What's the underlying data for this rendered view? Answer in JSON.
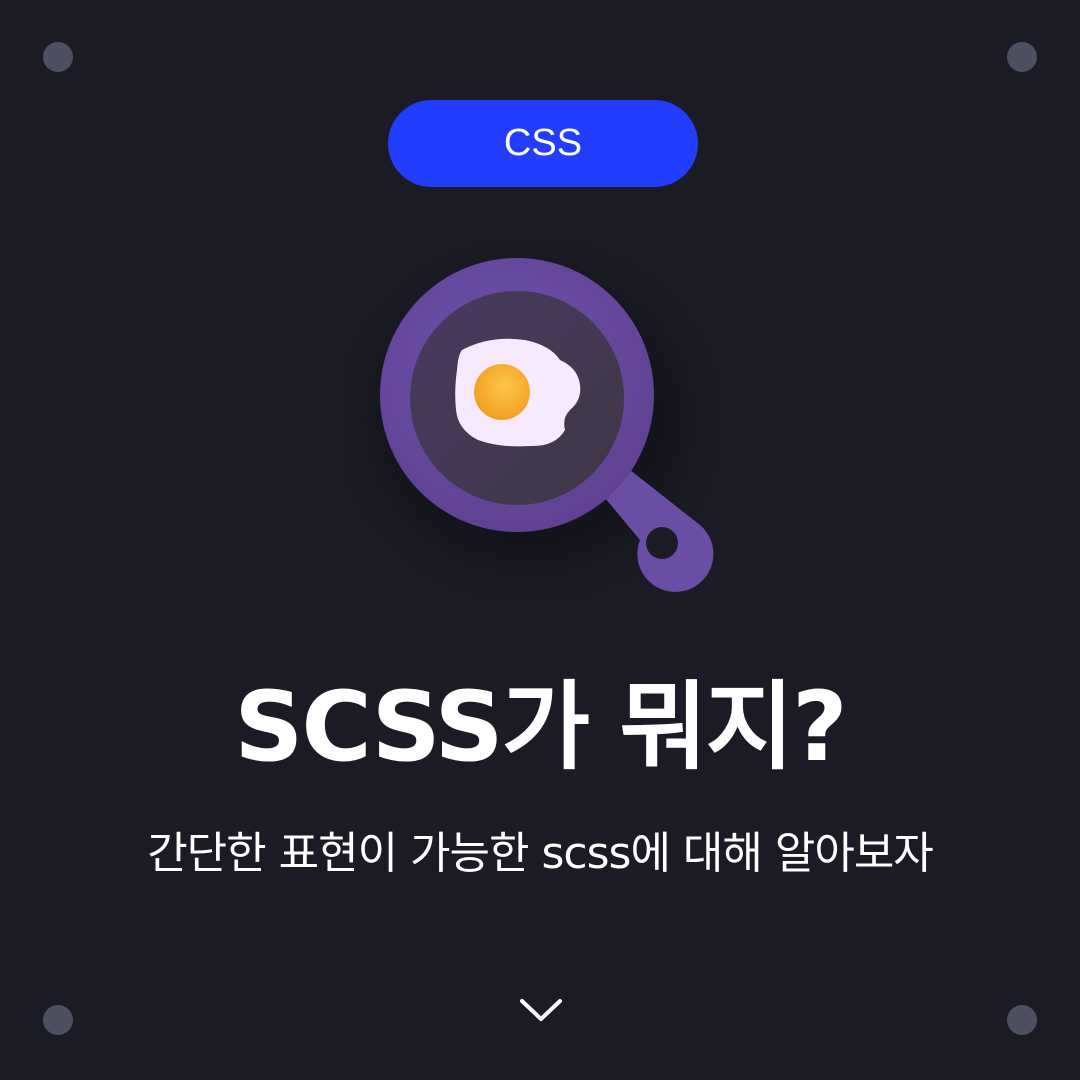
{
  "badge": {
    "label": "CSS",
    "color": "#223dfe"
  },
  "title": "SCSS가 뭐지?",
  "subtitle": "간단한 표현이 가능한 scss에 대해 알아보자",
  "illustration": {
    "icon": "frying-pan-with-egg-icon",
    "pan_color": "#6a4a9e"
  },
  "next": {
    "icon": "chevron-down-icon"
  },
  "colors": {
    "background": "#1b1b25",
    "corner_dot": "#4f4f62"
  }
}
